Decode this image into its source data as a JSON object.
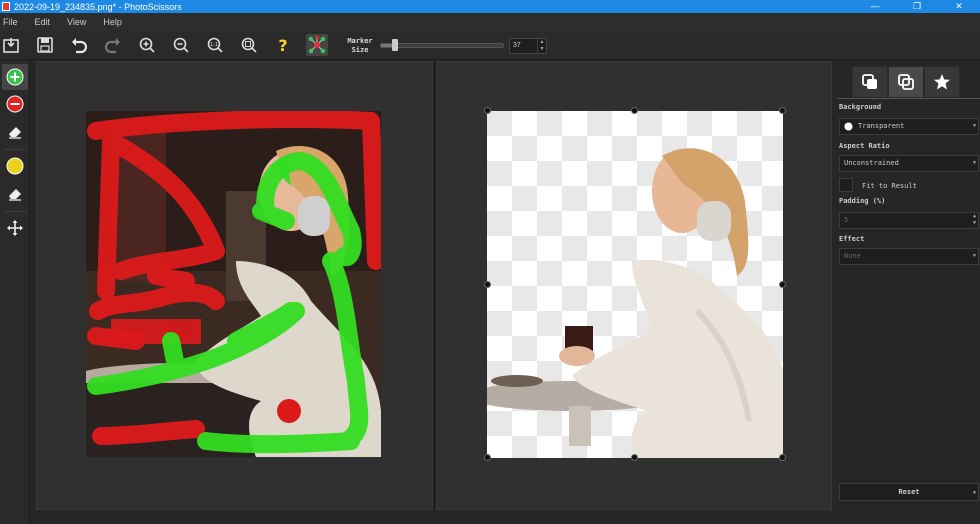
{
  "window": {
    "title": "2022-09-19_234835.png* - PhotoScissors",
    "controls": [
      "—",
      "❐",
      "✕"
    ]
  },
  "menu": [
    "File",
    "Edit",
    "View",
    "Help"
  ],
  "toolbar": {
    "marker_label_1": "Marker",
    "marker_label_2": "Size",
    "marker_size": "37",
    "marker_size_fraction": 0.12
  },
  "settings": {
    "tabs": [
      "layers-icon",
      "copy-icon",
      "star-icon"
    ],
    "background_label": "Background",
    "background_value": "Transparent",
    "aspect_label": "Aspect Ratio",
    "aspect_value": "Unconstrained",
    "fit_label": "Fit to Result",
    "padding_label": "Padding (%)",
    "padding_value": "5",
    "effect_label": "Effect",
    "effect_value": "None",
    "reset_label": "Reset"
  },
  "colors": {
    "titlebar": "#1e88e5",
    "marker_keep": "#33dd22",
    "marker_remove": "#dd1a1a",
    "help": "#ffd21f"
  }
}
